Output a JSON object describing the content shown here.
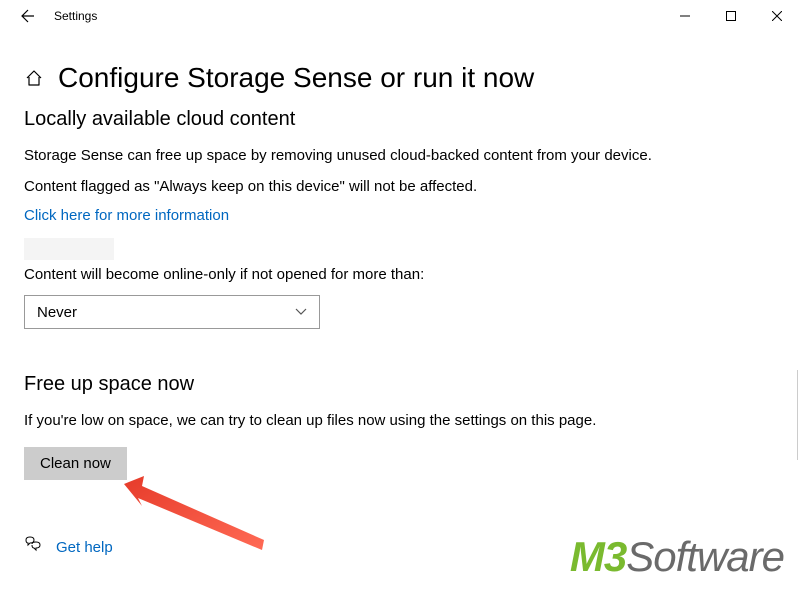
{
  "titleBar": {
    "appName": "Settings"
  },
  "page": {
    "title": "Configure Storage Sense or run it now"
  },
  "cloudSection": {
    "heading": "Locally available cloud content",
    "description1": "Storage Sense can free up space by removing unused cloud-backed content from your device.",
    "description2": "Content flagged as \"Always keep on this device\" will not be affected.",
    "infoLink": "Click here for more information",
    "onlineOnlyLabel": "Content will become online-only if not opened for more than:",
    "dropdownValue": "Never"
  },
  "freeUpSection": {
    "heading": "Free up space now",
    "description": "If you're low on space, we can try to clean up files now using the settings on this page.",
    "buttonLabel": "Clean now"
  },
  "footer": {
    "helpLink": "Get help"
  },
  "watermark": {
    "brand": "M3",
    "name": "Software"
  }
}
